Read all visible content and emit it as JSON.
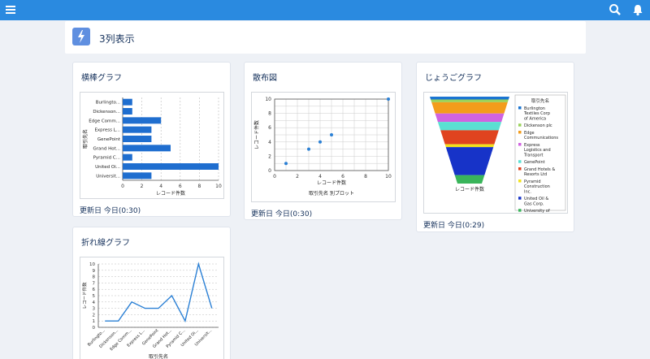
{
  "header": {
    "title": "3列表示",
    "icon": "lightning-icon"
  },
  "topbar": {
    "menu_icon": "hamburger-icon",
    "search_icon": "search-icon",
    "bell_icon": "bell-icon"
  },
  "colors": {
    "topbar": "#2a8ae0",
    "bar": "#1f6ecf",
    "line": "#2b80d5"
  },
  "cards": {
    "bar": {
      "title": "横棒グラフ",
      "updated": "更新日 今日(0:30)"
    },
    "scatter": {
      "title": "散布図",
      "updated": "更新日 今日(0:30)"
    },
    "funnel": {
      "title": "じょうごグラフ",
      "updated": "更新日 今日(0:29)"
    },
    "line": {
      "title": "折れ線グラフ",
      "updated": ""
    }
  },
  "chart_data": [
    {
      "type": "bar",
      "orientation": "horizontal",
      "categories": [
        "Burlingto...",
        "Dickenson...",
        "Edge Comm...",
        "Express L...",
        "GenePoint",
        "Grand Hot...",
        "Pyramid C...",
        "United Oi...",
        "Universit..."
      ],
      "values": [
        1,
        1,
        4,
        3,
        3,
        5,
        1,
        10,
        3
      ],
      "xlabel": "レコード件数",
      "ylabel": "取引先名",
      "xticks": [
        0,
        2,
        4,
        6,
        8,
        10
      ],
      "xlim": [
        0,
        10
      ]
    },
    {
      "type": "scatter",
      "x": [
        1,
        3,
        4,
        5,
        10
      ],
      "y": [
        1,
        3,
        4,
        5,
        10
      ],
      "xlabel": "レコード件数",
      "xlabel2": "取引先名 別プロット",
      "ylabel": "レコード件数",
      "xticks": [
        0,
        2,
        4,
        6,
        8,
        10
      ],
      "yticks": [
        0,
        2,
        4,
        6,
        8,
        10
      ],
      "xlim": [
        0,
        10
      ],
      "ylim": [
        0,
        10
      ]
    },
    {
      "type": "funnel",
      "legend_title": "取引先名",
      "xlabel": "レコード件数",
      "series": [
        {
          "name": "Burlington Textiles Corp of America",
          "value": 1,
          "color": "#1b75d1"
        },
        {
          "name": "Dickenson plc",
          "value": 1,
          "color": "#9ad25a"
        },
        {
          "name": "Edge Communications",
          "value": 4,
          "color": "#f39c1b"
        },
        {
          "name": "Express Logistics and Transport",
          "value": 3,
          "color": "#d063e0"
        },
        {
          "name": "GenePoint",
          "value": 3,
          "color": "#5ae0d2"
        },
        {
          "name": "Grand Hotels & Resorts Ltd",
          "value": 5,
          "color": "#e0431f"
        },
        {
          "name": "Pyramid Construction Inc.",
          "value": 1,
          "color": "#f2e21b"
        },
        {
          "name": "United Oil & Gas Corp.",
          "value": 10,
          "color": "#1733c8"
        },
        {
          "name": "University of Arizona",
          "value": 3,
          "color": "#39b55a"
        }
      ]
    },
    {
      "type": "line",
      "categories": [
        "Burlingto...",
        "Dickenson...",
        "Edge Comm...",
        "Express L...",
        "GenePoint",
        "Grand Hot...",
        "Pyramid C...",
        "United Oi...",
        "Universit..."
      ],
      "values": [
        1,
        1,
        4,
        3,
        3,
        5,
        1,
        10,
        3
      ],
      "xlabel": "取引先名",
      "ylabel": "レコード件数",
      "yticks": [
        0,
        1,
        2,
        3,
        4,
        5,
        6,
        7,
        8,
        9,
        10
      ],
      "ylim": [
        0,
        10
      ]
    }
  ]
}
